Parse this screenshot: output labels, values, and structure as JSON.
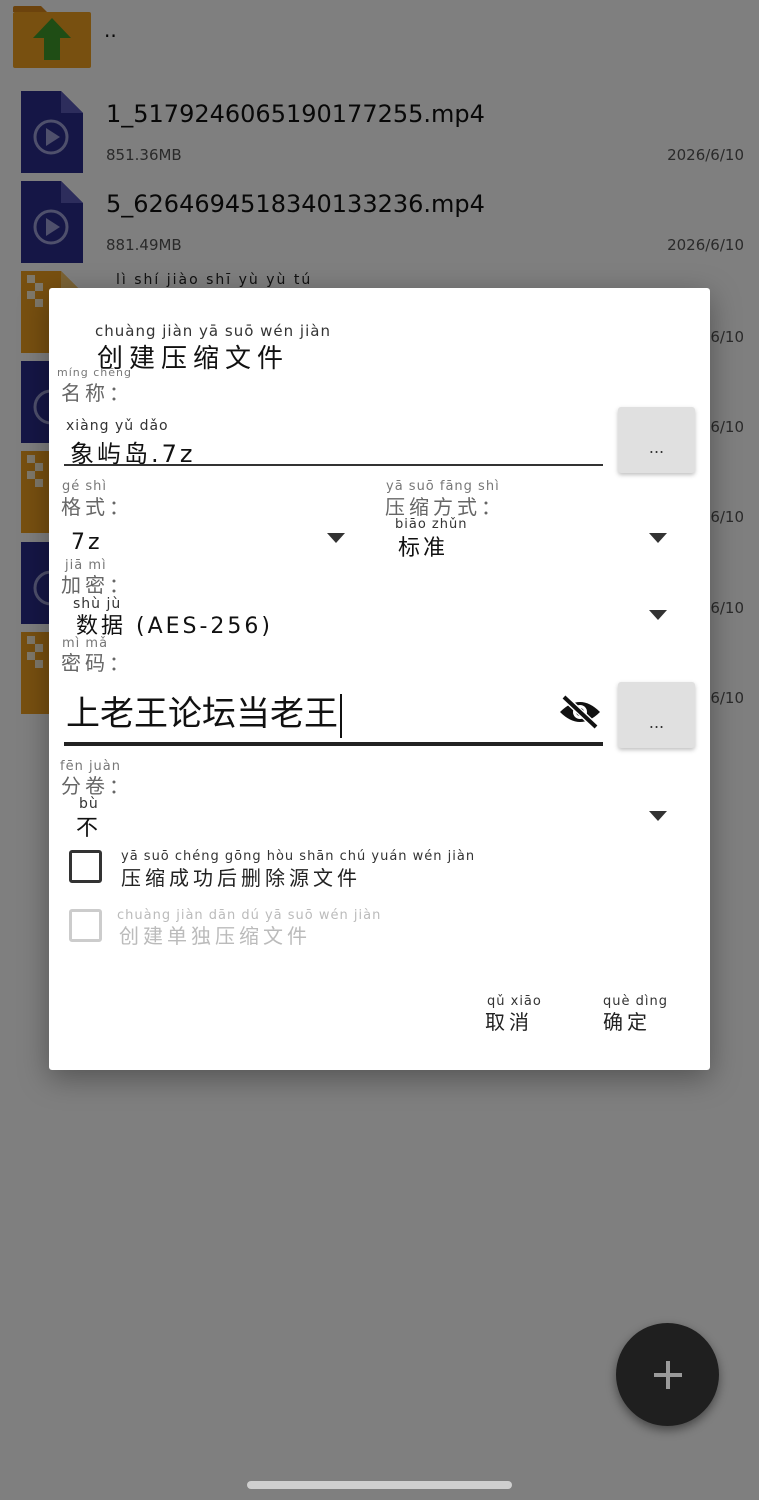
{
  "file_list": {
    "parent": {
      "name": ".."
    },
    "files": [
      {
        "name": "1_5179246065190177255.mp4",
        "size": "851.36MB",
        "date": "2026/6/10"
      },
      {
        "name": "5_6264694518340133236.mp4",
        "size": "881.49MB",
        "date": "2026/6/10"
      }
    ],
    "partial_pinyin": "lì shí jiào shī yù yù tú",
    "partial_dates": [
      "6/10",
      "6/10",
      "6/10",
      "6/10",
      "6/10"
    ]
  },
  "dialog": {
    "title": "创建压缩文件",
    "title_pinyin": "chuàng jiàn yā suō wén jiàn",
    "name_label": "名称：",
    "name_label_pinyin": "míng chēng",
    "name_value": "象屿岛.7z",
    "name_value_pinyin": "xiàng yǔ dǎo",
    "name_browse_button": "...",
    "format_label": "格式：",
    "format_label_pinyin": "gé shì",
    "format_value": "7z",
    "method_label": "压缩方式：",
    "method_label_pinyin": "yā suō fāng shì",
    "method_value": "标准",
    "method_value_pinyin": "biāo zhǔn",
    "encrypt_label": "加密：",
    "encrypt_label_pinyin": "jiā mì",
    "encrypt_value": "数据 (AES-256)",
    "encrypt_value_pinyin": "shù jù",
    "password_label": "密码：",
    "password_label_pinyin": "mì mǎ",
    "password_value": "上老王论坛当老王",
    "password_button": "...",
    "split_label": "分卷：",
    "split_label_pinyin": "fēn juàn",
    "split_value": "不",
    "split_value_pinyin": "bù",
    "delete_source_label": "压缩成功后删除源文件",
    "delete_source_pinyin": "yā suō chéng gōng hòu shān chú yuán wén jiàn",
    "separate_label": "创建单独压缩文件",
    "separate_pinyin": "chuàng jiàn dān dú yā suō wén jiàn",
    "cancel_label": "取消",
    "cancel_pinyin": "qǔ xiāo",
    "ok_label": "确定",
    "ok_pinyin": "què dìng"
  },
  "colors": {
    "video_icon": "#2b2c8c",
    "folder_orange": "#f0a020",
    "arrow_green": "#3e9a2a",
    "fab": "#1f1f1f"
  }
}
